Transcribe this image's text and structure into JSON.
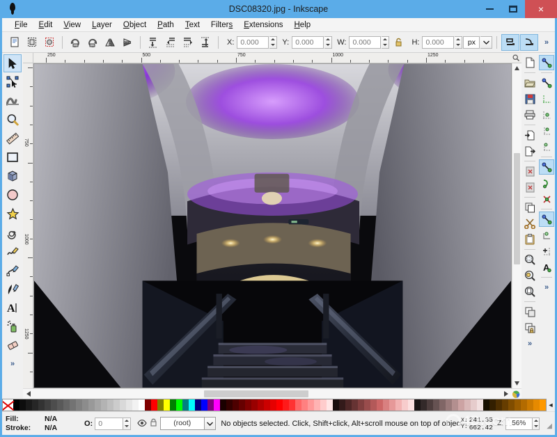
{
  "window": {
    "title": "DSC08320.jpg - Inkscape",
    "app_icon": "inkscape-logo-icon",
    "buttons": {
      "minimize": "minimize-icon",
      "maximize": "maximize-icon",
      "close": "×"
    }
  },
  "menubar": {
    "items": [
      {
        "label": "File",
        "mnemonic": "F"
      },
      {
        "label": "Edit",
        "mnemonic": "E"
      },
      {
        "label": "View",
        "mnemonic": "V"
      },
      {
        "label": "Layer",
        "mnemonic": "L"
      },
      {
        "label": "Object",
        "mnemonic": "O"
      },
      {
        "label": "Path",
        "mnemonic": "P"
      },
      {
        "label": "Text",
        "mnemonic": "T"
      },
      {
        "label": "Filters",
        "mnemonic": "s"
      },
      {
        "label": "Extensions",
        "mnemonic": "E"
      },
      {
        "label": "Help",
        "mnemonic": "H"
      }
    ]
  },
  "commandbar": {
    "buttons": [
      "select-all-icon",
      "select-all-in-layers-icon",
      "deselect-icon",
      "rotate-90-ccw-icon",
      "rotate-90-cw-icon",
      "flip-horizontal-icon",
      "flip-vertical-icon",
      "raise-to-top-icon",
      "raise-icon",
      "lower-icon",
      "lower-to-bottom-icon"
    ],
    "fields": [
      {
        "name": "x",
        "label": "X:",
        "value": "0.000"
      },
      {
        "name": "y",
        "label": "Y:",
        "value": "0.000"
      },
      {
        "name": "w",
        "label": "W:",
        "value": "0.000"
      },
      {
        "name": "h",
        "label": "H:",
        "value": "0.000"
      }
    ],
    "lock_icon": "lock-ratio-icon",
    "unit": "px",
    "toggles": [
      "affect-stroke-width-icon",
      "affect-rounded-corners-icon"
    ],
    "overflow": "»"
  },
  "toolbox": {
    "tools": [
      {
        "name": "selector-tool",
        "icon": "arrow-cursor-icon",
        "active": true
      },
      {
        "name": "node-tool",
        "icon": "node-editor-icon",
        "active": false
      },
      {
        "name": "tweak-tool",
        "icon": "tweak-icon",
        "active": false
      },
      {
        "name": "zoom-tool",
        "icon": "magnifier-icon",
        "active": false
      },
      {
        "name": "measure-tool",
        "icon": "ruler-icon",
        "active": false
      },
      {
        "name": "rectangle-tool",
        "icon": "square-icon",
        "active": false
      },
      {
        "name": "box3d-tool",
        "icon": "cube-icon",
        "active": false
      },
      {
        "name": "ellipse-tool",
        "icon": "circle-icon",
        "active": false
      },
      {
        "name": "star-tool",
        "icon": "star-icon",
        "active": false
      },
      {
        "name": "spiral-tool",
        "icon": "spiral-icon",
        "active": false
      },
      {
        "name": "pencil-tool",
        "icon": "pencil-icon",
        "active": false
      },
      {
        "name": "bezier-tool",
        "icon": "pen-icon",
        "active": false
      },
      {
        "name": "calligraphy-tool",
        "icon": "calligraphy-icon",
        "active": false
      },
      {
        "name": "text-tool",
        "icon": "text-a-icon",
        "active": false
      },
      {
        "name": "spray-tool",
        "icon": "spray-can-icon",
        "active": false
      },
      {
        "name": "eraser-tool",
        "icon": "eraser-icon",
        "active": false
      }
    ],
    "overflow": "»"
  },
  "rulers": {
    "horizontal": {
      "labels": [
        "250",
        "500",
        "750",
        "1000",
        "1250"
      ]
    },
    "vertical": {
      "labels": [
        "750",
        "1000",
        "1250"
      ]
    },
    "zoom_corner_icon": "magnifier-icon"
  },
  "canvas": {
    "image_description": "aircraft-cabin-staircase-photo",
    "scrollbars": {
      "left_arrow": "‹",
      "right_arrow": "›",
      "up_arrow": "^",
      "down_arrow": "v"
    },
    "color_wheel_icon": "color-wheel-icon"
  },
  "dock": {
    "file_column": [
      "new-document-icon",
      "open-document-icon",
      "save-document-icon",
      "print-icon",
      "import-icon",
      "export-icon",
      "undo-history-icon",
      "redo-history-icon",
      "copy-icon",
      "cut-scissors-icon",
      "paste-clipboard-icon",
      "zoom-selection-icon",
      "zoom-drawing-icon",
      "zoom-page-icon",
      "duplicate-icon",
      "group-lock-icon"
    ],
    "snap_column": [
      "snap-enable-icon",
      "snap-bbox-icon",
      "snap-bbox-edge-icon",
      "snap-bbox-corner-icon",
      "snap-bbox-edge-midpoint-icon",
      "snap-bbox-center-icon",
      "snap-nodes-icon",
      "snap-path-icon",
      "snap-path-intersection-icon",
      "snap-node-cusp-icon",
      "snap-smooth-node-icon",
      "snap-midpoint-icon",
      "snap-text-baseline-icon"
    ],
    "active_snap_indices": [
      0,
      6
    ],
    "overflow": "»"
  },
  "palette": {
    "none_swatch_label": "None",
    "colors": [
      "#000000",
      "#0d0d0d",
      "#1a1a1a",
      "#262626",
      "#333333",
      "#404040",
      "#4d4d4d",
      "#595959",
      "#666666",
      "#737373",
      "#808080",
      "#8c8c8c",
      "#999999",
      "#a6a6a6",
      "#b3b3b3",
      "#bfbfbf",
      "#cccccc",
      "#d9d9d9",
      "#e6e6e6",
      "#f2f2f2",
      "#ffffff",
      "#800000",
      "#ff0000",
      "#808000",
      "#ffff00",
      "#008000",
      "#00ff00",
      "#008080",
      "#00ffff",
      "#000080",
      "#0000ff",
      "#800080",
      "#ff00ff",
      "#1a0000",
      "#330000",
      "#4d0000",
      "#660000",
      "#800000",
      "#990000",
      "#b30000",
      "#cc0000",
      "#e60000",
      "#ff0000",
      "#ff1a1a",
      "#ff3333",
      "#ff6666",
      "#ff8080",
      "#ff9999",
      "#ffb3b3",
      "#ffcccc",
      "#ffe6e6",
      "#1a0d0d",
      "#331a1a",
      "#4d2626",
      "#663333",
      "#803f3f",
      "#994c4c",
      "#b35959",
      "#cc6666",
      "#d98080",
      "#e69999",
      "#f2b3b3",
      "#f7cccc",
      "#fbe0e0",
      "#1a1414",
      "#332929",
      "#4d3d3d",
      "#665252",
      "#806666",
      "#997a7a",
      "#b38f8f",
      "#cca3a3",
      "#d9b8b8",
      "#e6cccc",
      "#f2e0e0",
      "#1a0f00",
      "#331f00",
      "#4d2e00",
      "#663d00",
      "#804d00",
      "#995c00",
      "#b36b00",
      "#cc7a00",
      "#e68a00",
      "#ff9900"
    ],
    "scroll_arrow": "◄"
  },
  "statusbar": {
    "fill_label": "Fill:",
    "fill_value": "N/A",
    "stroke_label": "Stroke:",
    "stroke_value": "N/A",
    "opacity_label": "O:",
    "opacity_value": "0",
    "visibility_icon": "eye-icon",
    "lock_icon": "lock-icon",
    "layer_value": "(root)",
    "layer_dropdown_icon": "chevron-down-icon",
    "message": "No objects selected. Click, Shift+click, Alt+scroll mouse on top of objects.",
    "coord_x_label": "X:",
    "coord_x_value": "241.35",
    "coord_y_label": "Y:",
    "coord_y_value": "662.42",
    "zoom_label": "Z:",
    "zoom_value": "56%",
    "resize_grip": "resize-grip-icon"
  },
  "watermark": {
    "text": "4D.com",
    "prefix": "10"
  },
  "colors": {
    "titlebar": "#5bace8",
    "close_button": "#cf5055",
    "toolbar_bg": "#f0f0f0",
    "active_tool": "#cfe4f7",
    "active_toggle": "#bcddf5"
  }
}
